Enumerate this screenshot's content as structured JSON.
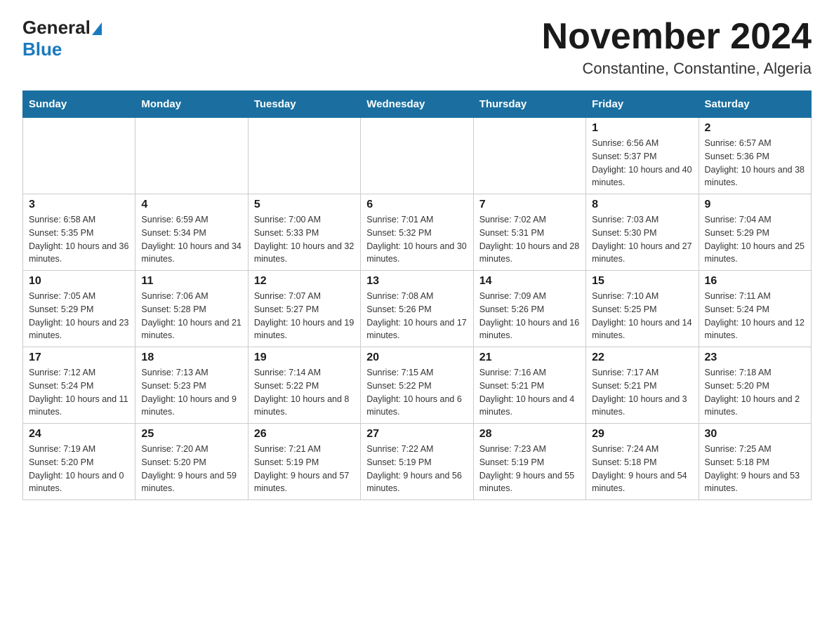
{
  "logo": {
    "general": "General",
    "blue": "Blue"
  },
  "header": {
    "month_year": "November 2024",
    "location": "Constantine, Constantine, Algeria"
  },
  "days_of_week": [
    "Sunday",
    "Monday",
    "Tuesday",
    "Wednesday",
    "Thursday",
    "Friday",
    "Saturday"
  ],
  "weeks": [
    [
      {
        "day": "",
        "sunrise": "",
        "sunset": "",
        "daylight": ""
      },
      {
        "day": "",
        "sunrise": "",
        "sunset": "",
        "daylight": ""
      },
      {
        "day": "",
        "sunrise": "",
        "sunset": "",
        "daylight": ""
      },
      {
        "day": "",
        "sunrise": "",
        "sunset": "",
        "daylight": ""
      },
      {
        "day": "",
        "sunrise": "",
        "sunset": "",
        "daylight": ""
      },
      {
        "day": "1",
        "sunrise": "Sunrise: 6:56 AM",
        "sunset": "Sunset: 5:37 PM",
        "daylight": "Daylight: 10 hours and 40 minutes."
      },
      {
        "day": "2",
        "sunrise": "Sunrise: 6:57 AM",
        "sunset": "Sunset: 5:36 PM",
        "daylight": "Daylight: 10 hours and 38 minutes."
      }
    ],
    [
      {
        "day": "3",
        "sunrise": "Sunrise: 6:58 AM",
        "sunset": "Sunset: 5:35 PM",
        "daylight": "Daylight: 10 hours and 36 minutes."
      },
      {
        "day": "4",
        "sunrise": "Sunrise: 6:59 AM",
        "sunset": "Sunset: 5:34 PM",
        "daylight": "Daylight: 10 hours and 34 minutes."
      },
      {
        "day": "5",
        "sunrise": "Sunrise: 7:00 AM",
        "sunset": "Sunset: 5:33 PM",
        "daylight": "Daylight: 10 hours and 32 minutes."
      },
      {
        "day": "6",
        "sunrise": "Sunrise: 7:01 AM",
        "sunset": "Sunset: 5:32 PM",
        "daylight": "Daylight: 10 hours and 30 minutes."
      },
      {
        "day": "7",
        "sunrise": "Sunrise: 7:02 AM",
        "sunset": "Sunset: 5:31 PM",
        "daylight": "Daylight: 10 hours and 28 minutes."
      },
      {
        "day": "8",
        "sunrise": "Sunrise: 7:03 AM",
        "sunset": "Sunset: 5:30 PM",
        "daylight": "Daylight: 10 hours and 27 minutes."
      },
      {
        "day": "9",
        "sunrise": "Sunrise: 7:04 AM",
        "sunset": "Sunset: 5:29 PM",
        "daylight": "Daylight: 10 hours and 25 minutes."
      }
    ],
    [
      {
        "day": "10",
        "sunrise": "Sunrise: 7:05 AM",
        "sunset": "Sunset: 5:29 PM",
        "daylight": "Daylight: 10 hours and 23 minutes."
      },
      {
        "day": "11",
        "sunrise": "Sunrise: 7:06 AM",
        "sunset": "Sunset: 5:28 PM",
        "daylight": "Daylight: 10 hours and 21 minutes."
      },
      {
        "day": "12",
        "sunrise": "Sunrise: 7:07 AM",
        "sunset": "Sunset: 5:27 PM",
        "daylight": "Daylight: 10 hours and 19 minutes."
      },
      {
        "day": "13",
        "sunrise": "Sunrise: 7:08 AM",
        "sunset": "Sunset: 5:26 PM",
        "daylight": "Daylight: 10 hours and 17 minutes."
      },
      {
        "day": "14",
        "sunrise": "Sunrise: 7:09 AM",
        "sunset": "Sunset: 5:26 PM",
        "daylight": "Daylight: 10 hours and 16 minutes."
      },
      {
        "day": "15",
        "sunrise": "Sunrise: 7:10 AM",
        "sunset": "Sunset: 5:25 PM",
        "daylight": "Daylight: 10 hours and 14 minutes."
      },
      {
        "day": "16",
        "sunrise": "Sunrise: 7:11 AM",
        "sunset": "Sunset: 5:24 PM",
        "daylight": "Daylight: 10 hours and 12 minutes."
      }
    ],
    [
      {
        "day": "17",
        "sunrise": "Sunrise: 7:12 AM",
        "sunset": "Sunset: 5:24 PM",
        "daylight": "Daylight: 10 hours and 11 minutes."
      },
      {
        "day": "18",
        "sunrise": "Sunrise: 7:13 AM",
        "sunset": "Sunset: 5:23 PM",
        "daylight": "Daylight: 10 hours and 9 minutes."
      },
      {
        "day": "19",
        "sunrise": "Sunrise: 7:14 AM",
        "sunset": "Sunset: 5:22 PM",
        "daylight": "Daylight: 10 hours and 8 minutes."
      },
      {
        "day": "20",
        "sunrise": "Sunrise: 7:15 AM",
        "sunset": "Sunset: 5:22 PM",
        "daylight": "Daylight: 10 hours and 6 minutes."
      },
      {
        "day": "21",
        "sunrise": "Sunrise: 7:16 AM",
        "sunset": "Sunset: 5:21 PM",
        "daylight": "Daylight: 10 hours and 4 minutes."
      },
      {
        "day": "22",
        "sunrise": "Sunrise: 7:17 AM",
        "sunset": "Sunset: 5:21 PM",
        "daylight": "Daylight: 10 hours and 3 minutes."
      },
      {
        "day": "23",
        "sunrise": "Sunrise: 7:18 AM",
        "sunset": "Sunset: 5:20 PM",
        "daylight": "Daylight: 10 hours and 2 minutes."
      }
    ],
    [
      {
        "day": "24",
        "sunrise": "Sunrise: 7:19 AM",
        "sunset": "Sunset: 5:20 PM",
        "daylight": "Daylight: 10 hours and 0 minutes."
      },
      {
        "day": "25",
        "sunrise": "Sunrise: 7:20 AM",
        "sunset": "Sunset: 5:20 PM",
        "daylight": "Daylight: 9 hours and 59 minutes."
      },
      {
        "day": "26",
        "sunrise": "Sunrise: 7:21 AM",
        "sunset": "Sunset: 5:19 PM",
        "daylight": "Daylight: 9 hours and 57 minutes."
      },
      {
        "day": "27",
        "sunrise": "Sunrise: 7:22 AM",
        "sunset": "Sunset: 5:19 PM",
        "daylight": "Daylight: 9 hours and 56 minutes."
      },
      {
        "day": "28",
        "sunrise": "Sunrise: 7:23 AM",
        "sunset": "Sunset: 5:19 PM",
        "daylight": "Daylight: 9 hours and 55 minutes."
      },
      {
        "day": "29",
        "sunrise": "Sunrise: 7:24 AM",
        "sunset": "Sunset: 5:18 PM",
        "daylight": "Daylight: 9 hours and 54 minutes."
      },
      {
        "day": "30",
        "sunrise": "Sunrise: 7:25 AM",
        "sunset": "Sunset: 5:18 PM",
        "daylight": "Daylight: 9 hours and 53 minutes."
      }
    ]
  ]
}
